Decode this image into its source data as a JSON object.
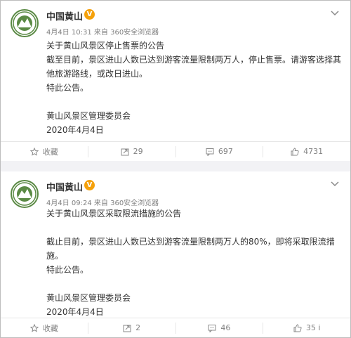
{
  "posts": [
    {
      "author": "中国黄山",
      "verified_badge": "V",
      "time": "4月4日 10:31",
      "source": "来自 360安全浏览器",
      "lines": [
        "关于黄山风景区停止售票的公告",
        "截至目前，景区进山人数已达到游客流量限制两万人，停止售票。请游客选择其",
        "他旅游路线，或改日进山。",
        "特此公告。",
        "",
        "黄山风景区管理委员会",
        "2020年4月4日"
      ],
      "actions": {
        "favorite": "收藏",
        "repost": "29",
        "comment": "697",
        "like": "4731"
      }
    },
    {
      "author": "中国黄山",
      "verified_badge": "V",
      "time": "4月4日 09:24",
      "source": "来自 360安全浏览器",
      "lines": [
        "关于黄山风景区采取限流措施的公告",
        "",
        "截止目前，景区进山人数已达到游客流量限制两万人的80%，即将采取限流措施。",
        "特此公告。",
        "",
        "黄山风景区管理委员会",
        "2020年4月4日"
      ],
      "actions": {
        "favorite": "收藏",
        "repost": "2",
        "comment": "46",
        "like": "35 i"
      }
    }
  ],
  "icons": {
    "avatar": "huangshan-logo-icon",
    "more": "chevron-down-icon",
    "favorite": "star-icon",
    "repost": "repost-icon",
    "comment": "comment-icon",
    "like": "thumbs-up-icon"
  },
  "colors": {
    "verified": "#f5a10b",
    "logo_green": "#5b8a45",
    "text": "#333333",
    "meta": "#808080"
  }
}
